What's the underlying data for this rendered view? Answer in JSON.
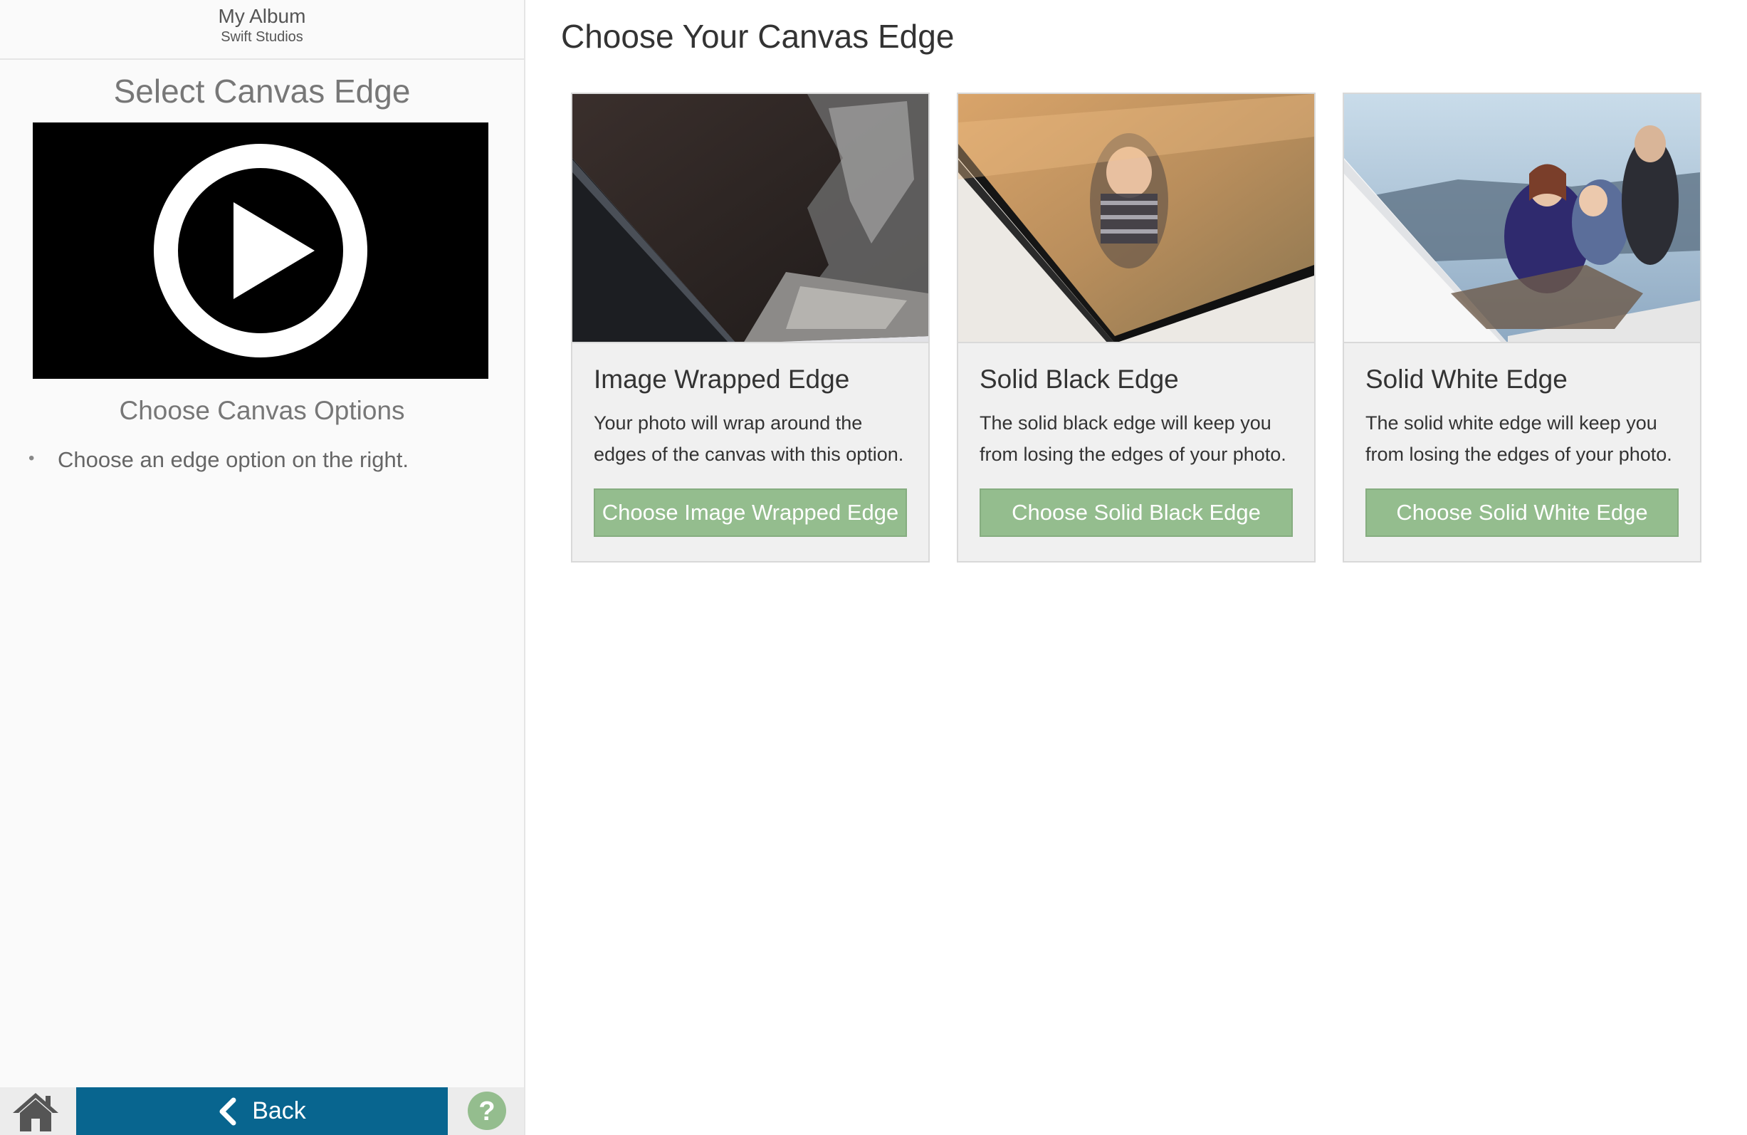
{
  "album": {
    "title": "My Album",
    "subtitle": "Swift Studios"
  },
  "sidebar": {
    "heading": "Select Canvas Edge",
    "video": {
      "icon": "play-icon"
    },
    "subheading": "Choose Canvas Options",
    "instructions": [
      "Choose an edge option on the right."
    ]
  },
  "bottom_bar": {
    "home_icon": "home-icon",
    "back_label": "Back",
    "help_icon": "help-icon"
  },
  "main": {
    "title": "Choose Your Canvas Edge",
    "cards": [
      {
        "title": "Image Wrapped Edge",
        "desc": "Your photo will wrap around the edges of the canvas with this option.",
        "button": "Choose Image Wrapped Edge"
      },
      {
        "title": "Solid Black Edge",
        "desc": "The solid black edge will keep you from losing the edges of your photo.",
        "button": "Choose Solid Black Edge"
      },
      {
        "title": "Solid White Edge",
        "desc": "The solid white edge will keep you from losing the edges of your photo.",
        "button": "Choose Solid White Edge"
      }
    ]
  },
  "colors": {
    "back_button": "#08658f",
    "choose_button": "#94bd8e",
    "help_icon": "#94bd8e",
    "home_icon": "#555555"
  }
}
